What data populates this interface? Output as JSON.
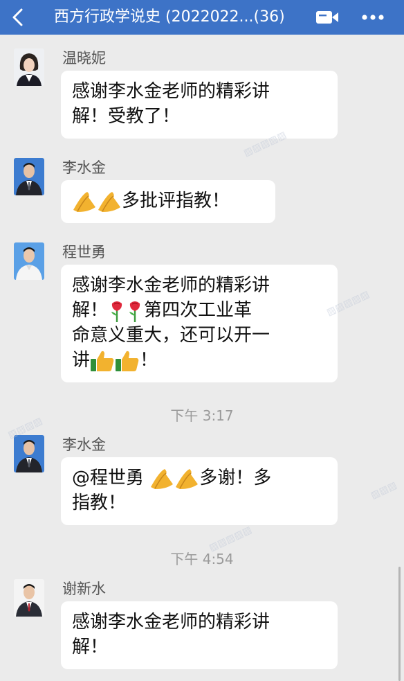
{
  "header": {
    "title": "西方行政学说史 (2022022...(36)",
    "back_icon": "chevron-left-icon",
    "video_icon": "video-camera-icon",
    "more_icon": "more-dots-icon"
  },
  "messages": [
    {
      "sender": "温晓妮",
      "line1": "感谢李水金老师的精彩讲",
      "line2": "解！受教了！"
    },
    {
      "sender": "李水金",
      "text": "多批评指教！"
    },
    {
      "sender": "程世勇",
      "line1": "感谢李水金老师的精彩讲",
      "line2a": "解！",
      "line2b": "第四次工业革",
      "line3": "命意义重大，还可以开一",
      "line4a": "讲",
      "line4b": "！"
    },
    {
      "sender": "李水金",
      "mention": "@程世勇",
      "line1b": "多谢！多",
      "line2": "指教！"
    },
    {
      "sender": "谢新水",
      "line1": "感谢李水金老师的精彩讲",
      "line2": "解！"
    }
  ],
  "timestamps": {
    "t1": "下午 3:17",
    "t2": "下午 4:54"
  },
  "colors": {
    "header": "#3d73c7",
    "background": "#ebebeb",
    "bubble": "#ffffff"
  }
}
